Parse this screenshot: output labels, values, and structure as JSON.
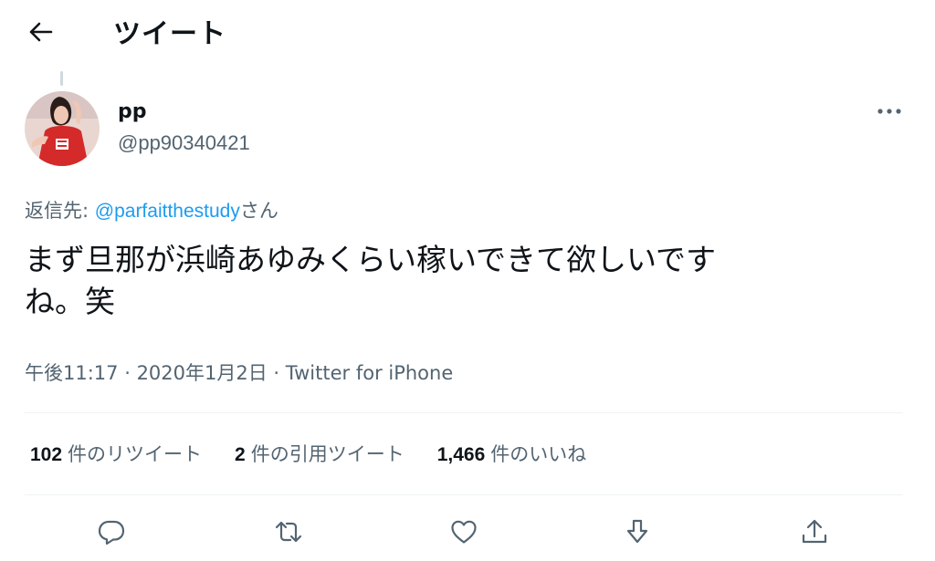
{
  "header": {
    "title": "ツイート"
  },
  "user": {
    "name": "pp",
    "handle": "@pp90340421"
  },
  "reply": {
    "prefix": "返信先: ",
    "mention": "@parfaitthestudy",
    "suffix": "さん"
  },
  "tweet": {
    "lines": [
      "まず旦那が浜崎あゆみくらい稼いできて欲しいです",
      "ね。笑"
    ]
  },
  "meta": {
    "time": "午後11:17",
    "sep1": " · ",
    "date": "2020年1月2日",
    "sep2": " · ",
    "source": "Twitter for iPhone"
  },
  "stats": {
    "retweets": {
      "count": "102",
      "label": "件のリツイート"
    },
    "quotes": {
      "count": "2",
      "label": "件の引用ツイート"
    },
    "likes": {
      "count": "1,466",
      "label": "件のいいね"
    }
  },
  "icons": [
    "back-arrow-icon",
    "more-icon",
    "reply-icon",
    "retweet-icon",
    "like-icon",
    "bookmark-icon",
    "share-icon"
  ],
  "colors": {
    "accent": "#1d9bf0",
    "text": "#0f1419",
    "secondary": "#536471",
    "divider": "#eff3f4"
  }
}
